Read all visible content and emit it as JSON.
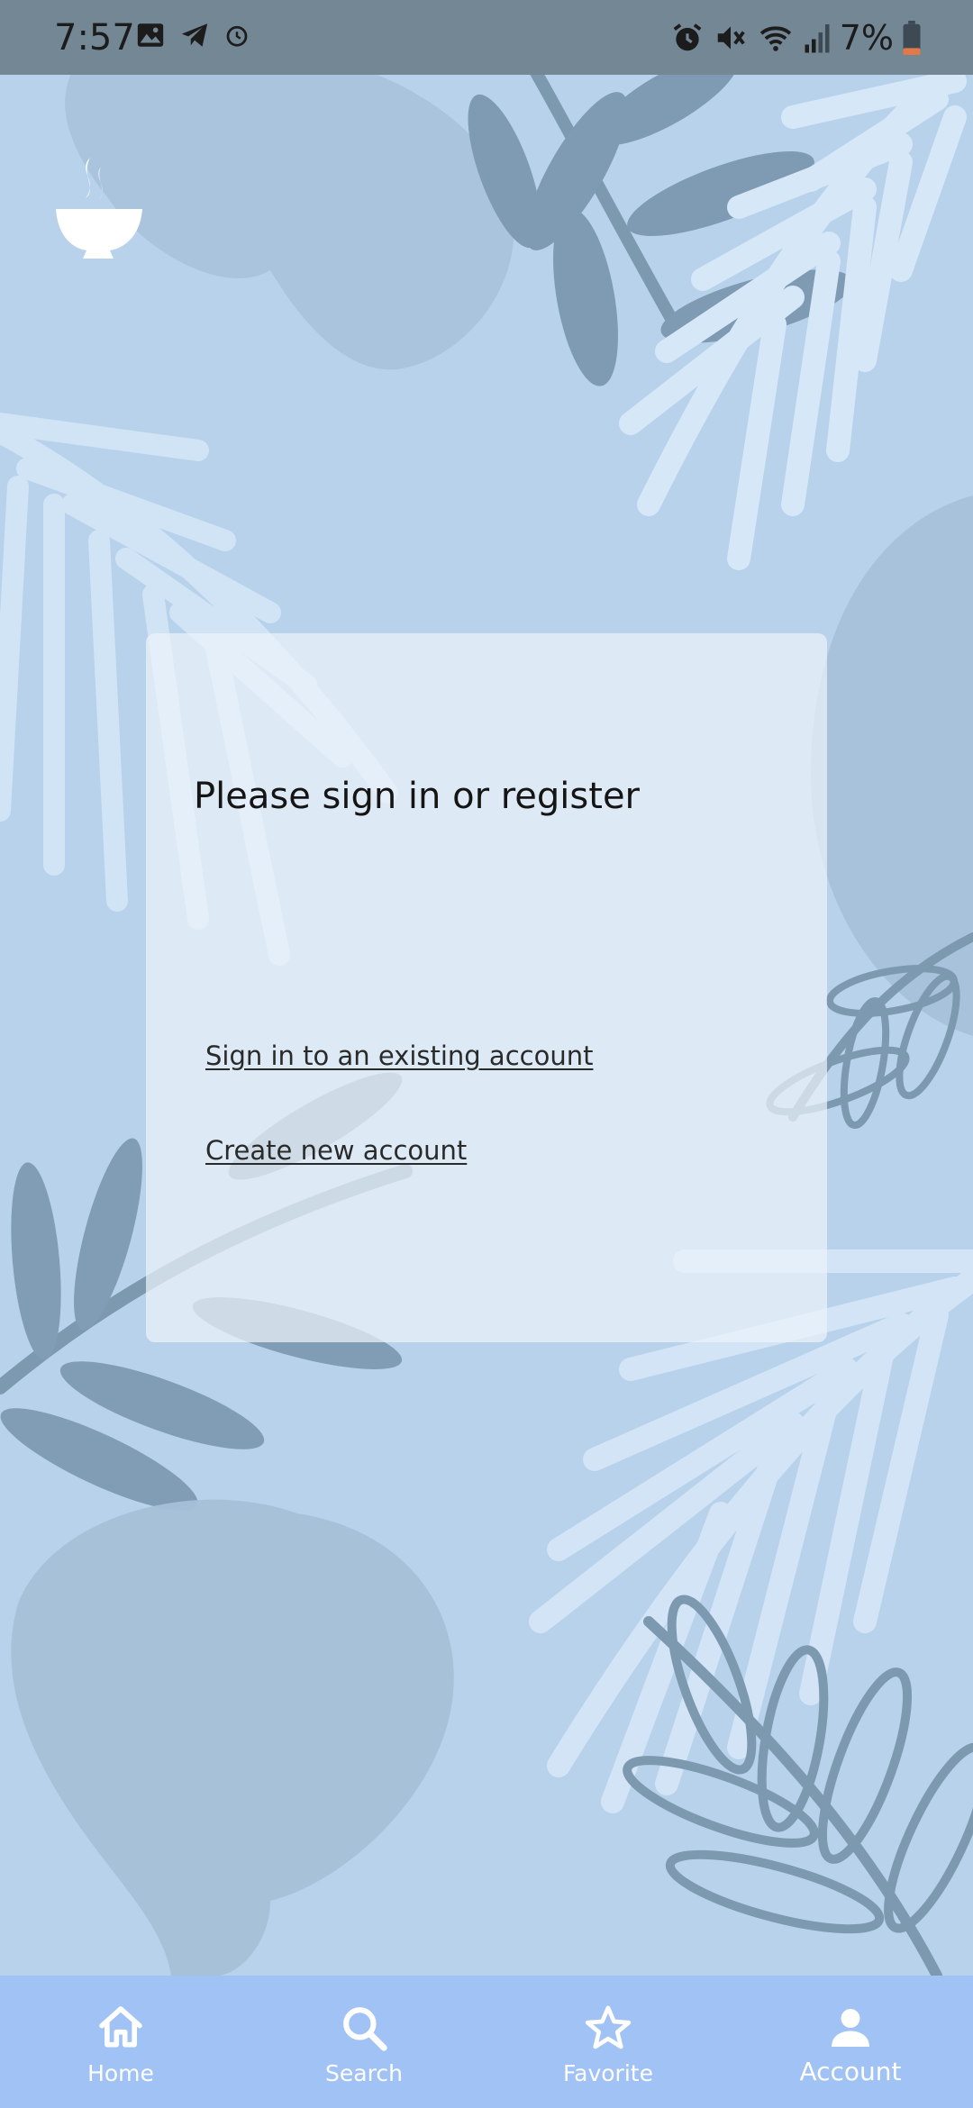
{
  "status_bar": {
    "time": "7:57",
    "battery": "7%",
    "left_icons": [
      "image-icon",
      "telegram-icon",
      "alarm-icon"
    ],
    "right_icons": [
      "alarm-icon",
      "mute-icon",
      "wifi-icon",
      "signal-icon",
      "battery-icon"
    ]
  },
  "logo": {
    "icon": "coffee-cup-icon"
  },
  "card": {
    "title": "Please sign in or register",
    "signin_link": "Sign in to an existing account",
    "create_link": "Create new account"
  },
  "bottom_nav": {
    "items": [
      {
        "label": "Home",
        "icon": "home-icon",
        "active": false
      },
      {
        "label": "Search",
        "icon": "search-icon",
        "active": false
      },
      {
        "label": "Favorite",
        "icon": "star-icon",
        "active": false
      },
      {
        "label": "Account",
        "icon": "person-icon",
        "active": true
      }
    ]
  },
  "colors": {
    "background": "#b7d2ea",
    "status_bar": "#748795",
    "bottom_nav": "#a0c2f4",
    "card": "#e6eff8"
  }
}
